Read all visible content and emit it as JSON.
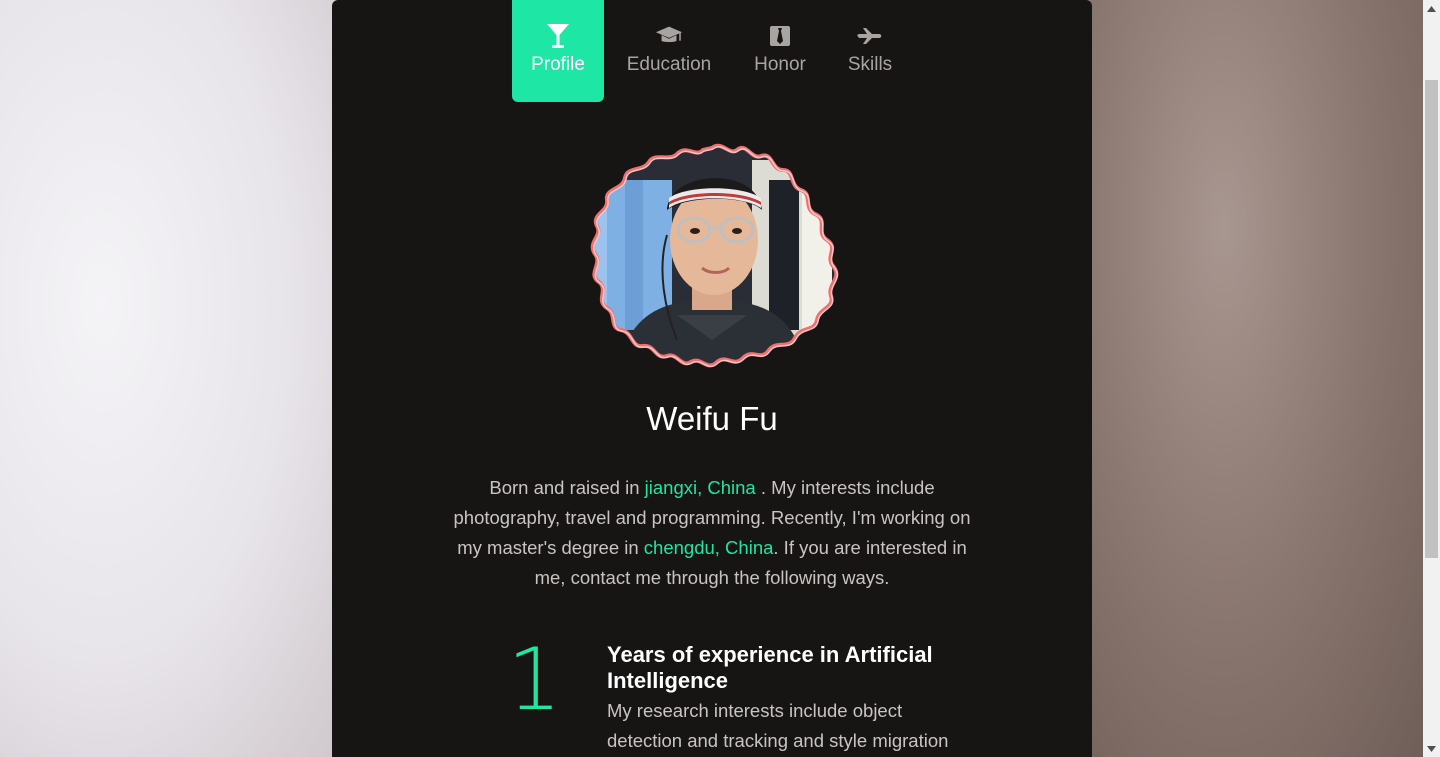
{
  "tabs": [
    {
      "label": "Profile",
      "icon": "cocktail-icon",
      "active": true
    },
    {
      "label": "Education",
      "icon": "graduation-cap-icon",
      "active": false
    },
    {
      "label": "Honor",
      "icon": "tie-icon",
      "active": false
    },
    {
      "label": "Skills",
      "icon": "plane-icon",
      "active": false
    }
  ],
  "profile": {
    "name": "Weifu Fu",
    "bio_part1": "Born and raised in ",
    "bio_link1": "jiangxi, China",
    "bio_part2": " . My interests include photography, travel and programming. Recently, I'm working on my master's degree in ",
    "bio_link2": "chengdu, China",
    "bio_part3": ". If you are interested in me, contact me through the following ways."
  },
  "stat": {
    "number": "1",
    "title": "Years of experience in Artificial Intelligence",
    "description": "My research interests include object detection and tracking and style migration"
  },
  "colors": {
    "accent": "#1ee6a4",
    "card_bg": "#171414",
    "avatar_border": "#f07070"
  }
}
